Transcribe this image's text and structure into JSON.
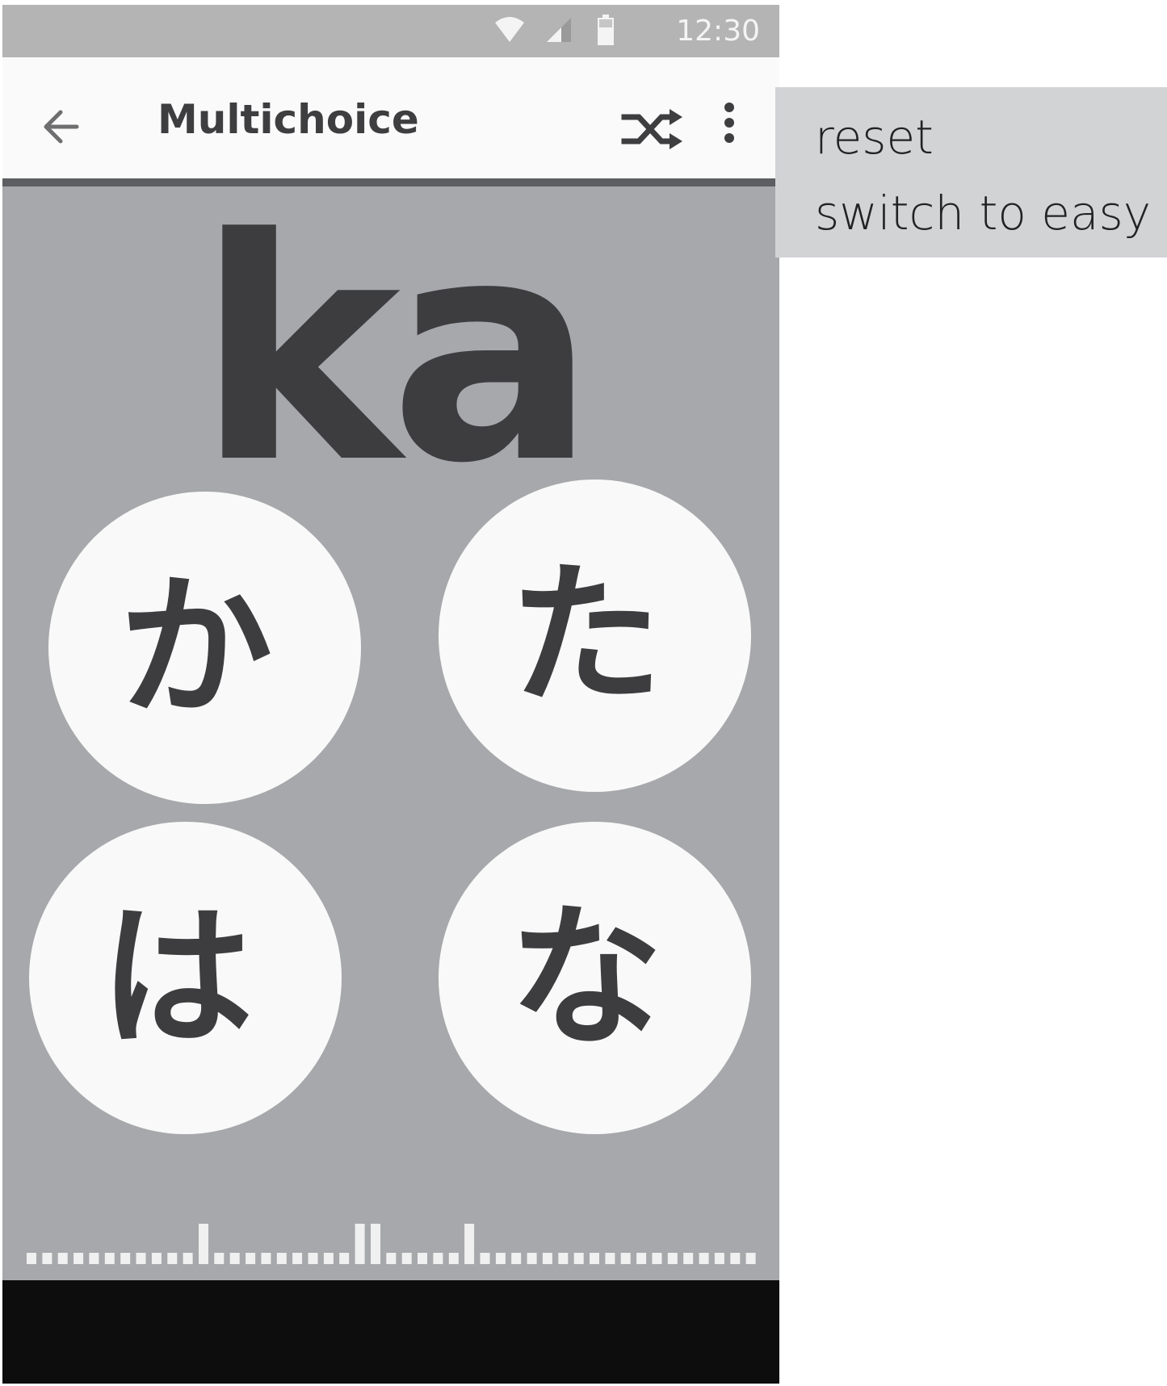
{
  "status_bar": {
    "time": "12:30",
    "icons": [
      "wifi-icon",
      "cell-signal-icon",
      "battery-icon"
    ]
  },
  "app_bar": {
    "title": "Multichoice",
    "back_icon": "arrow-back-icon",
    "shuffle_icon": "shuffle-icon",
    "overflow_icon": "more-vert-icon"
  },
  "quiz": {
    "prompt": "ka",
    "choices": [
      "か",
      "た",
      "は",
      "な"
    ]
  },
  "progress": {
    "levels": [
      0,
      0,
      0,
      0,
      0,
      0,
      0,
      0,
      0,
      0,
      0,
      1,
      0,
      0,
      0,
      0,
      0,
      0,
      0,
      0,
      0,
      1,
      1,
      0,
      0,
      0,
      0,
      0,
      1,
      0,
      0,
      0,
      0,
      0,
      0,
      0,
      0,
      0,
      0,
      0,
      0,
      0,
      0,
      0,
      0,
      0,
      0
    ]
  },
  "overflow_menu": {
    "items": [
      "reset",
      "switch to easy"
    ]
  },
  "colors": {
    "background": "#a7a8ab",
    "app_bar": "#fafafa",
    "text_dark": "#3d3d3f",
    "choice_bg": "#f9f9f9",
    "menu_bg": "#d2d3d5",
    "nav_bar": "#0d0d0d",
    "status_bar": "#b4b4b4",
    "progress_bar": "#f0f0f0"
  }
}
